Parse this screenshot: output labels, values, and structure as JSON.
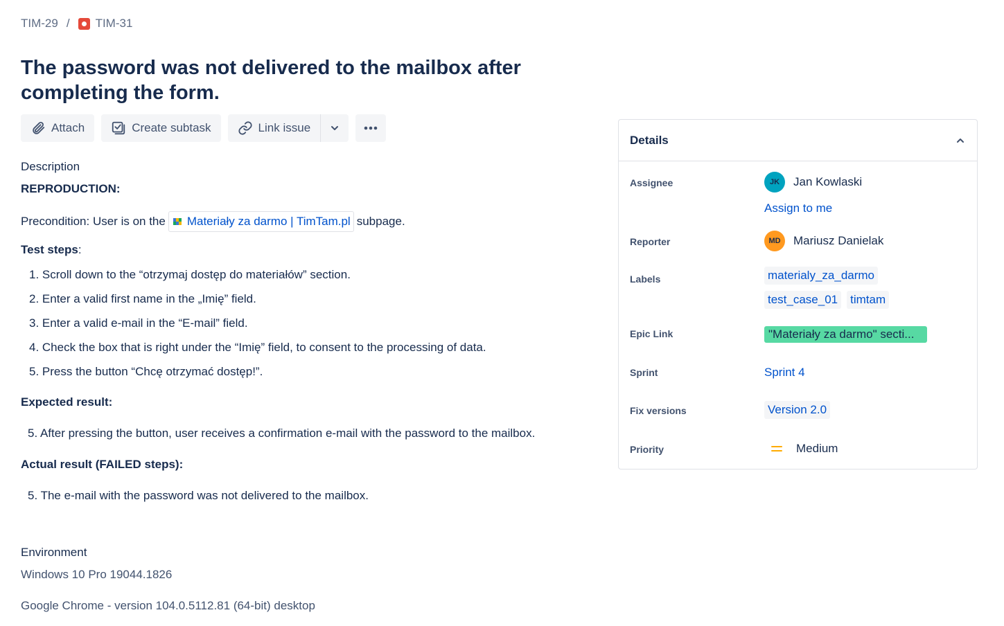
{
  "breadcrumb": {
    "parent": "TIM-29",
    "separator": "/",
    "current": "TIM-31"
  },
  "issue": {
    "title": "The password was not delivered to the mailbox after completing the form."
  },
  "toolbar": {
    "attach_label": "Attach",
    "create_subtask_label": "Create subtask",
    "link_issue_label": "Link issue"
  },
  "description": {
    "heading": "Description",
    "reproduction_heading": "REPRODUCTION:",
    "precondition_prefix": "Precondition: User is on the",
    "precondition_link": "Materiały za darmo | TimTam.pl",
    "precondition_suffix": "subpage.",
    "test_steps_heading": "Test steps",
    "test_steps_colon": ":",
    "steps": [
      "1. Scroll down to the “otrzymaj dostęp do materiałów” section.",
      "2. Enter a valid first name in the „Imię” field.",
      "3. Enter a valid e-mail in the “E-mail” field.",
      "4. Check the box that is right under the “Imię” field, to consent to the processing of data.",
      "5. Press the button “Chcę otrzymać dostęp!”."
    ],
    "expected_heading": "Expected result:",
    "expected_value": "5. After pressing the button, user receives a confirmation e-mail with the password to the mailbox.",
    "actual_heading": "Actual result (FAILED steps):",
    "actual_value": "5. The e-mail with the password was not delivered to the mailbox."
  },
  "environment": {
    "heading": "Environment",
    "line1": "Windows 10 Pro 19044.1826",
    "line2": "Google Chrome - version 104.0.5112.81 (64-bit) desktop"
  },
  "details": {
    "heading": "Details",
    "assignee_label": "Assignee",
    "assignee_initials": "JK",
    "assignee_name": "Jan Kowlaski",
    "assign_to_me": "Assign to me",
    "reporter_label": "Reporter",
    "reporter_initials": "MD",
    "reporter_name": "Mariusz Danielak",
    "labels_label": "Labels",
    "labels": [
      "materialy_za_darmo",
      "test_case_01",
      "timtam"
    ],
    "epic_label": "Epic Link",
    "epic_value": "\"Materiały za darmo\" secti...",
    "sprint_label": "Sprint",
    "sprint_value": "Sprint 4",
    "fix_versions_label": "Fix versions",
    "fix_version_value": "Version 2.0",
    "priority_label": "Priority",
    "priority_value": "Medium"
  },
  "colors": {
    "accent": "#0052cc",
    "epic": "#57d9a3",
    "bug": "#e5493a",
    "priority_medium": "#ffab00"
  }
}
